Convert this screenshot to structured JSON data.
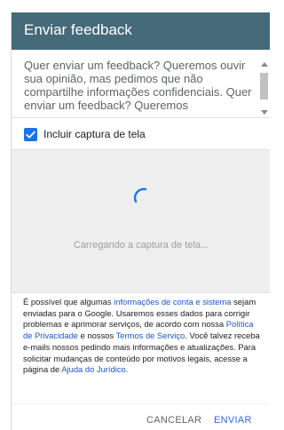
{
  "dialog": {
    "title": "Enviar feedback",
    "description": "Quer enviar um feedback? Queremos ouvir sua opinião, mas pedimos que não compartilhe informações confidenciais. Quer enviar um feedback? Queremos",
    "include_screenshot_label": "Incluir captura de tela",
    "include_screenshot_checked": true,
    "loading_text": "Carregando a captura de tela...",
    "legal": {
      "p1": "É possível que algumas ",
      "link_account_info": "informações de conta e sistema",
      "p2": " sejam enviadas para o Google. Usaremos esses dados para corrigir problemas e aprimorar serviços, de acordo com nossa ",
      "link_privacy": "Política de Privacidade",
      "p3": " e nossos ",
      "link_terms": "Termos de Serviço",
      "p4": ". Você talvez receba e-mails nossos pedindo mais informações e atualizações. Para solicitar mudanças de conteúdo por motivos legais, acesse a página de ",
      "link_legal_help": "Ajuda do Jurídico",
      "p5": "."
    },
    "cancel_label": "CANCELAR",
    "send_label": "ENVIAR"
  },
  "colors": {
    "header_bg": "#456a7a",
    "accent_blue": "#1a73e8",
    "link_blue": "#1a56c9"
  }
}
